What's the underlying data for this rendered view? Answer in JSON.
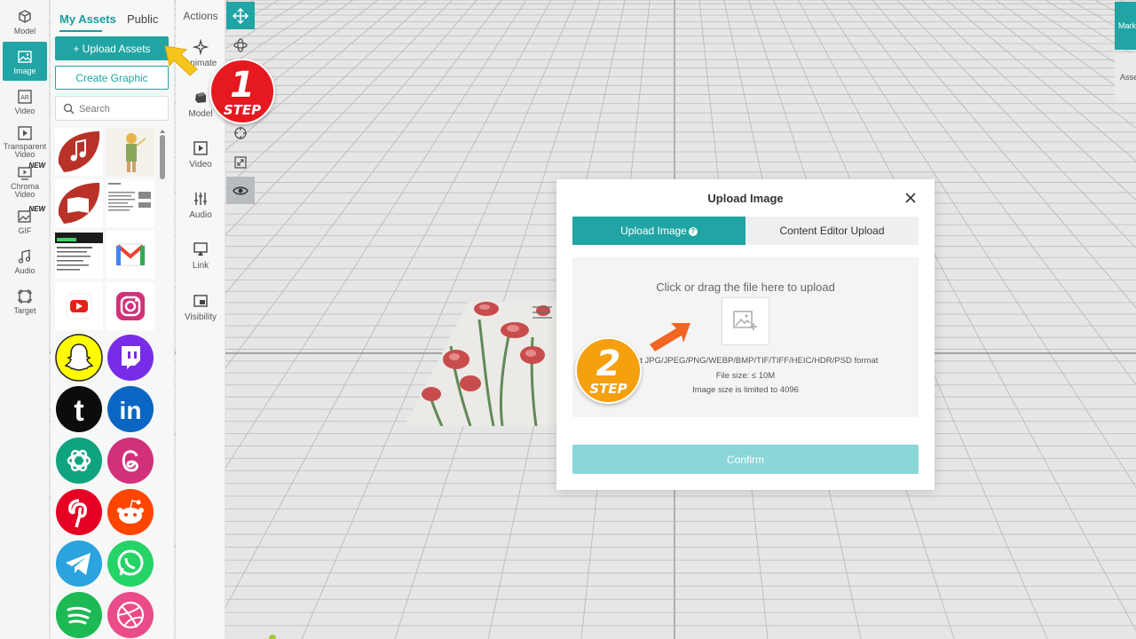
{
  "colors": {
    "accent": "#21a4a4",
    "step1": "#e5191f",
    "step2": "#f5a00f",
    "arrow1": "#f7c51e",
    "arrow2": "#f26522",
    "confirm_disabled": "#8ad6d8"
  },
  "left_rail": {
    "items": [
      {
        "label": "Model",
        "icon": "cube-icon"
      },
      {
        "label": "Image",
        "icon": "image-icon"
      },
      {
        "label": "Video",
        "icon": "ar-video-icon"
      },
      {
        "label": "Transparent Video",
        "icon": "play-icon"
      },
      {
        "label": "Chroma Video",
        "icon": "chroma-video-icon",
        "badge": "NEW"
      },
      {
        "label": "GIF",
        "icon": "gif-icon",
        "badge": "NEW"
      },
      {
        "label": "Audio",
        "icon": "music-note-icon"
      },
      {
        "label": "Target",
        "icon": "target-icon"
      }
    ]
  },
  "assets_panel": {
    "tabs": [
      "My Assets",
      "Public"
    ],
    "upload_label": "+ Upload Assets",
    "create_graphic_label": "Create Graphic",
    "search_placeholder": "Search"
  },
  "actions_panel": {
    "title": "Actions",
    "items": [
      {
        "label": "Animate",
        "icon": "sparkle-icon"
      },
      {
        "label": "Model",
        "icon": "model-icon"
      },
      {
        "label": "Video",
        "icon": "video-icon"
      },
      {
        "label": "Audio",
        "icon": "sliders-icon"
      },
      {
        "label": "Link",
        "icon": "link-icon"
      },
      {
        "label": "Visibility",
        "icon": "visibility-icon"
      }
    ]
  },
  "tools": [
    "move-icon",
    "rotate-icon",
    "scale-icon",
    "target-tool-icon",
    "resize-icon",
    "eye-icon"
  ],
  "right_tabs": [
    "Mark",
    "Asse"
  ],
  "steps": {
    "step1": {
      "number": "1",
      "label": "STEP"
    },
    "step2": {
      "number": "2",
      "label": "STEP"
    }
  },
  "modal": {
    "title": "Upload Image",
    "tabs": [
      "Upload Image",
      "Content Editor Upload"
    ],
    "help": "?",
    "drop_title": "Click or drag the file here to upload",
    "formats": "Support JPG/JPEG/PNG/WEBP/BMP/TIF/TIFF/HEIC/HDR/PSD format",
    "file_size": "File size: ≤ 10M",
    "image_size": "Image size is limited to 4096",
    "confirm_label": "Confirm"
  }
}
